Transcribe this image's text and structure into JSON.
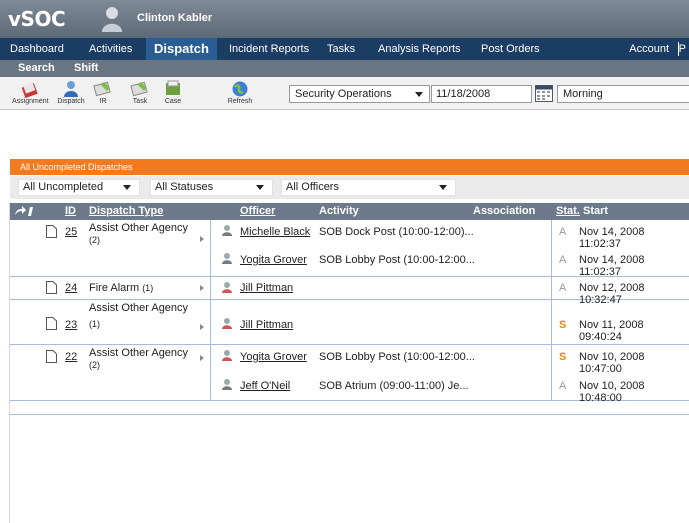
{
  "header": {
    "logo": "vSOC",
    "user_name": "Clinton Kabler"
  },
  "main_nav": {
    "items": [
      "Dashboard",
      "Activities",
      "Dispatch",
      "Incident Reports",
      "Tasks",
      "Analysis Reports",
      "Post Orders"
    ],
    "active": "Dispatch",
    "account": "Account",
    "cut_item": "P"
  },
  "sub_nav": {
    "items": [
      "Search",
      "Shift"
    ]
  },
  "toolbar": {
    "buttons": [
      "Assignment",
      "Dispatch",
      "IR",
      "Task",
      "Case",
      "Refresh"
    ],
    "org_select": "Security Operations",
    "date": "11/18/2008",
    "shift_select": "Morning"
  },
  "panel": {
    "title": "All Uncompleted Dispatches",
    "filters": [
      "All Uncompleted",
      "All Statuses",
      "All Officers"
    ]
  },
  "table": {
    "headers": {
      "id": "ID",
      "type": "Dispatch Type",
      "officer": "Officer",
      "activity": "Activity",
      "association": "Association",
      "stat": "Stat.",
      "start": "Start"
    },
    "groups": [
      {
        "id": "25",
        "type": "Assist Other Agency",
        "count": "(2)",
        "rows": [
          {
            "officer": "Michelle Black",
            "activity": "SOB Dock Post (10:00-12:00)...",
            "stat": "A",
            "start": "Nov 14, 2008 11:02:37"
          },
          {
            "officer": "Yogita Grover",
            "activity": "SOB Lobby Post (10:00-12:00...",
            "stat": "A",
            "start": "Nov 14, 2008 11:02:37"
          }
        ]
      },
      {
        "id": "24",
        "type": "Fire Alarm",
        "count": "(1)",
        "rows": [
          {
            "officer": "Jill Pittman",
            "activity": "",
            "stat": "A",
            "start": "Nov 12, 2008 10:32:47"
          }
        ]
      },
      {
        "id": "23",
        "type": "Assist Other Agency",
        "count": "(1)",
        "rows": [
          {
            "officer": "Jill Pittman",
            "activity": "",
            "stat": "S",
            "start": "Nov 11, 2008 09:40:24"
          }
        ]
      },
      {
        "id": "22",
        "type": "Assist Other Agency",
        "count": "(2)",
        "rows": [
          {
            "officer": "Yogita Grover",
            "activity": "SOB Lobby Post (10:00-12:00...",
            "stat": "S",
            "start": "Nov 10, 2008 10:47:00"
          },
          {
            "officer": "Jeff O'Neil",
            "activity": "SOB Atrium (09:00-11:00) Je...",
            "stat": "A",
            "start": "Nov 10, 2008 10:48:00"
          }
        ]
      }
    ]
  },
  "colors": {
    "nav_bg": "#1b3d63",
    "nav_active": "#2a5d93",
    "panel_orange": "#f37a1f",
    "header_row": "#6c7a8b",
    "status_S": "#e08a10",
    "status_A": "#999999"
  }
}
